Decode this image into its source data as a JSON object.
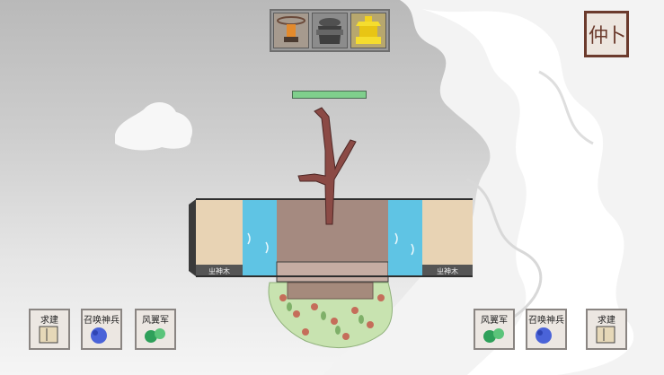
{
  "resource_tray": {
    "slots": [
      {
        "icon": "totem-icon"
      },
      {
        "icon": "cauldron-icon"
      },
      {
        "icon": "golden-temple-icon"
      }
    ]
  },
  "menu_button": {
    "glyph": "仲卜",
    "icon": "menu-scroll-icon"
  },
  "health_bar": {
    "fraction": 1.0,
    "color": "#7fcf8c"
  },
  "platform": {
    "left_sign": "ㄓ神木",
    "right_sign": "ㄓ神木"
  },
  "left_cards": [
    {
      "label": "求建",
      "icon": "book-icon"
    },
    {
      "label": "召唤神兵",
      "icon": "blue-summon-icon"
    },
    {
      "label": "风翼军",
      "icon": "green-gourd-icon"
    }
  ],
  "right_cards": [
    {
      "label": "风翼军",
      "icon": "green-gourd-icon"
    },
    {
      "label": "召唤神兵",
      "icon": "blue-summon-icon"
    },
    {
      "label": "求建",
      "icon": "book-icon"
    }
  ]
}
